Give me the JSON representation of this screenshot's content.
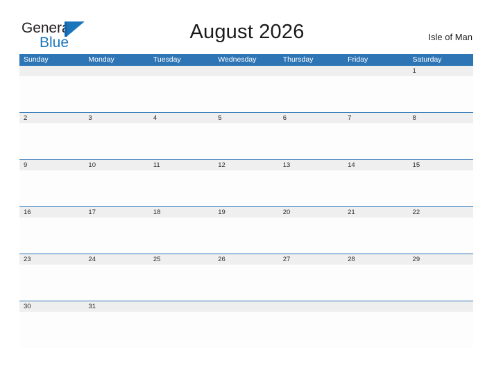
{
  "logo": {
    "word_top": "General",
    "word_bottom": "Blue",
    "icon": "flag-icon",
    "top_color": "#231f20",
    "bottom_color": "#1b75bb"
  },
  "header": {
    "title": "August 2026",
    "region": "Isle of Man"
  },
  "colors": {
    "header_blue": "#2e75b6",
    "date_band_gray": "#efefef",
    "row_divider": "#2e75b6",
    "cell_white": "#fdfdfd",
    "text_dark": "#2b2b2b",
    "header_text": "#ffffff"
  },
  "calendar": {
    "month": "August",
    "year": "2026",
    "weekday_headers": [
      "Sunday",
      "Monday",
      "Tuesday",
      "Wednesday",
      "Thursday",
      "Friday",
      "Saturday"
    ],
    "weeks": [
      [
        "",
        "",
        "",
        "",
        "",
        "",
        "1"
      ],
      [
        "2",
        "3",
        "4",
        "5",
        "6",
        "7",
        "8"
      ],
      [
        "9",
        "10",
        "11",
        "12",
        "13",
        "14",
        "15"
      ],
      [
        "16",
        "17",
        "18",
        "19",
        "20",
        "21",
        "22"
      ],
      [
        "23",
        "24",
        "25",
        "26",
        "27",
        "28",
        "29"
      ],
      [
        "30",
        "31",
        "",
        "",
        "",
        "",
        ""
      ]
    ]
  }
}
